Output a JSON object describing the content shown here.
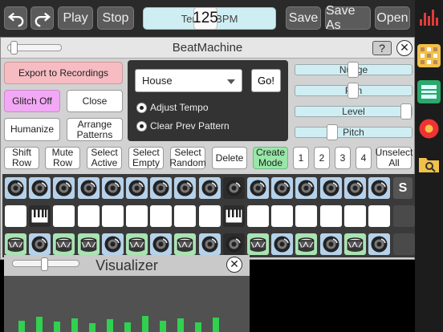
{
  "toolbar": {
    "undo_icon": "undo-arrow-icon",
    "redo_icon": "redo-arrow-icon",
    "play": "Play",
    "stop": "Stop",
    "tempo_label": "Tempo BPM",
    "tempo_value": "125",
    "save": "Save",
    "save_as": "Save As",
    "open": "Open"
  },
  "sidebar": {
    "icons": [
      "levels-icon",
      "beat-grid-icon",
      "keyboard-icon",
      "record-icon",
      "folder-search-icon"
    ]
  },
  "beatmachine": {
    "title": "BeatMachine",
    "help": "?",
    "close": "✕",
    "export": "Export to Recordings",
    "glitch": "Glitch Off",
    "close_btn": "Close",
    "humanize": "Humanize",
    "arrange": "Arrange Patterns",
    "preset": "House",
    "go": "Go!",
    "adjust_tempo": "Adjust Tempo",
    "clear_prev": "Clear Prev Pattern",
    "sliders": {
      "nudge": "Nudge",
      "pan": "Pan",
      "level": "Level",
      "pitch": "Pitch"
    },
    "slider_values": {
      "nudge": 0.5,
      "pan": 0.5,
      "level": 0.95,
      "pitch": 0.33
    },
    "actions": {
      "shift_row": "Shift Row",
      "mute_row": "Mute Row",
      "select_active": "Select Active",
      "select_empty": "Select Empty",
      "select_random": "Select Random",
      "delete": "Delete",
      "create_mode": "Create Mode",
      "p1": "1",
      "p2": "2",
      "p3": "3",
      "p4": "4",
      "unselect_all": "Unselect All"
    },
    "solo": "S",
    "rows": [
      {
        "instrument": "speaker-icon",
        "cells": [
          "blue",
          "blue",
          "blue",
          "blue",
          "blue",
          "blue",
          "blue",
          "blue",
          "blue",
          "dark",
          "blue",
          "blue",
          "blue",
          "blue",
          "blue",
          "blue"
        ]
      },
      {
        "instrument": "piano-icon",
        "cells": [
          "white",
          "dark-piano",
          "white",
          "white",
          "white",
          "white",
          "white",
          "white",
          "white",
          "dark-piano",
          "white",
          "white",
          "white",
          "white",
          "white",
          "white"
        ]
      },
      {
        "instrument": "drum-icon",
        "cells": [
          "green",
          "blue",
          "green",
          "green",
          "blue",
          "green",
          "blue",
          "green",
          "blue",
          "dark",
          "green",
          "blue",
          "green",
          "blue",
          "green",
          "blue"
        ]
      }
    ]
  },
  "visualizer": {
    "title": "Visualizer",
    "close": "✕",
    "bar_levels": [
      0.6,
      0.8,
      0.55,
      0.7,
      0.45,
      0.65,
      0.5,
      0.85,
      0.6,
      0.7,
      0.5,
      0.75
    ]
  }
}
